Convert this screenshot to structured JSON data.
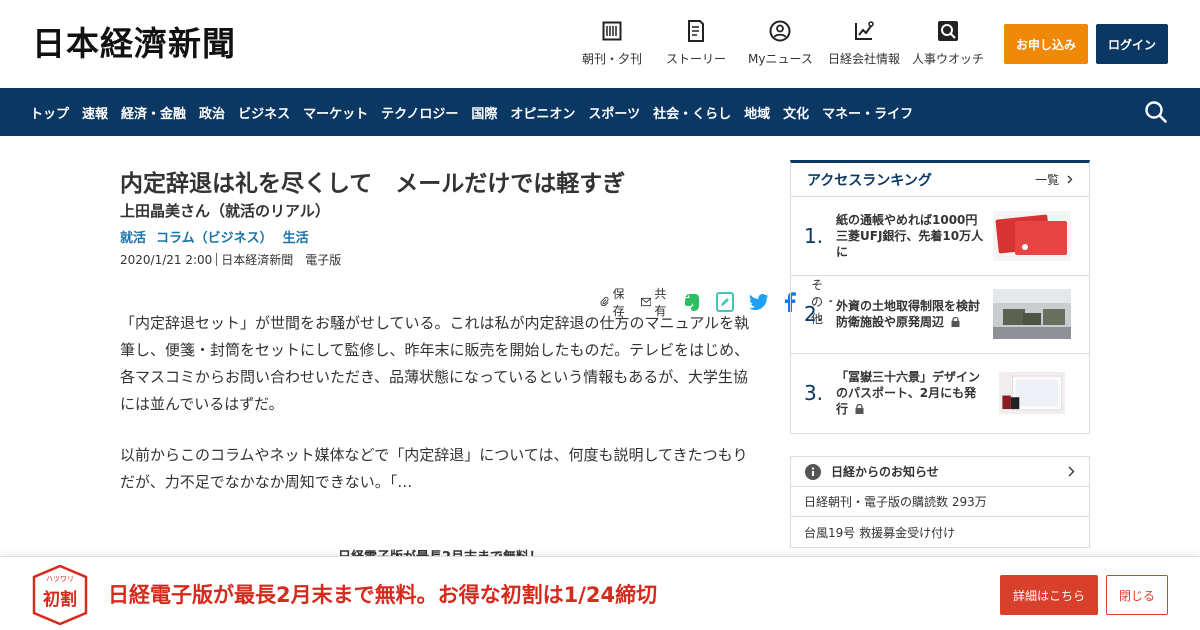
{
  "header": {
    "logo": "日本経濟新聞",
    "nav": [
      {
        "label": "朝刊・夕刊",
        "icon": "newspaper-icon"
      },
      {
        "label": "ストーリー",
        "icon": "document-icon"
      },
      {
        "label": "Myニュース",
        "icon": "user-icon"
      },
      {
        "label": "日経会社情報",
        "icon": "chart-icon"
      },
      {
        "label": "人事ウオッチ",
        "icon": "search-person-icon"
      }
    ],
    "apply_label": "お申し込み",
    "login_label": "ログイン"
  },
  "navbar": {
    "items": [
      "トップ",
      "速報",
      "経済・金融",
      "政治",
      "ビジネス",
      "マーケット",
      "テクノロジー",
      "国際",
      "オピニオン",
      "スポーツ",
      "社会・くらし",
      "地域",
      "文化",
      "マネー・ライフ"
    ]
  },
  "article": {
    "title": "内定辞退は礼を尽くして　メールだけでは軽すぎ",
    "subtitle": "上田晶美さん（就活のリアル）",
    "tags": [
      "就活",
      "コラム（ビジネス）",
      "生活"
    ],
    "date": "2020/1/21 2:00",
    "source": "日本経済新聞　電子版",
    "share": {
      "save": "保存",
      "share": "共有",
      "other": "その他"
    },
    "paragraph1": "「内定辞退セット」が世間をお騒がせしている。これは私が内定辞退の仕方のマニュアルを執筆し、便箋・封筒をセットにして監修し、昨年末に販売を開始したものだ。テレビをはじめ、各マスコミからお問い合わせいただき、品薄状態になっているという情報もあるが、大学生協には並んでいるはずだ。",
    "paragraph2": "以前からこのコラムやネット媒体などで「内定辞退」については、何度も説明してきたつもりだが、力不足でなかなか周知できない。「…",
    "promo_peek": "日経電子版が最長2月末まで無料！"
  },
  "ranking": {
    "title": "アクセスランキング",
    "more": "一覧",
    "items": [
      {
        "num": "1.",
        "text": "紙の通帳やめれば1000円　三菱UFJ銀行、先着10万人に",
        "locked": false
      },
      {
        "num": "2.",
        "text": "外資の土地取得制限を検討　防衛施設や原発周辺",
        "locked": true
      },
      {
        "num": "3.",
        "text": "「冨嶽三十六景」デザインのパスポート、2月にも発行",
        "locked": true
      }
    ]
  },
  "notice": {
    "title": "日経からのお知らせ",
    "items": [
      "日経朝刊・電子版の購読数 293万",
      "台風19号 救援募金受け付け"
    ]
  },
  "banner": {
    "badge_top": "ハツワリ",
    "badge": "初割",
    "text": "日経電子版が最長2月末まで無料。お得な初割は1/24締切",
    "detail_label": "詳細はこちら",
    "close_label": "閉じる"
  },
  "colors": {
    "brand_navy": "#0b3763",
    "apply_orange": "#f0880a",
    "banner_red": "#d42b1e",
    "tag_blue": "#1a73a8"
  }
}
